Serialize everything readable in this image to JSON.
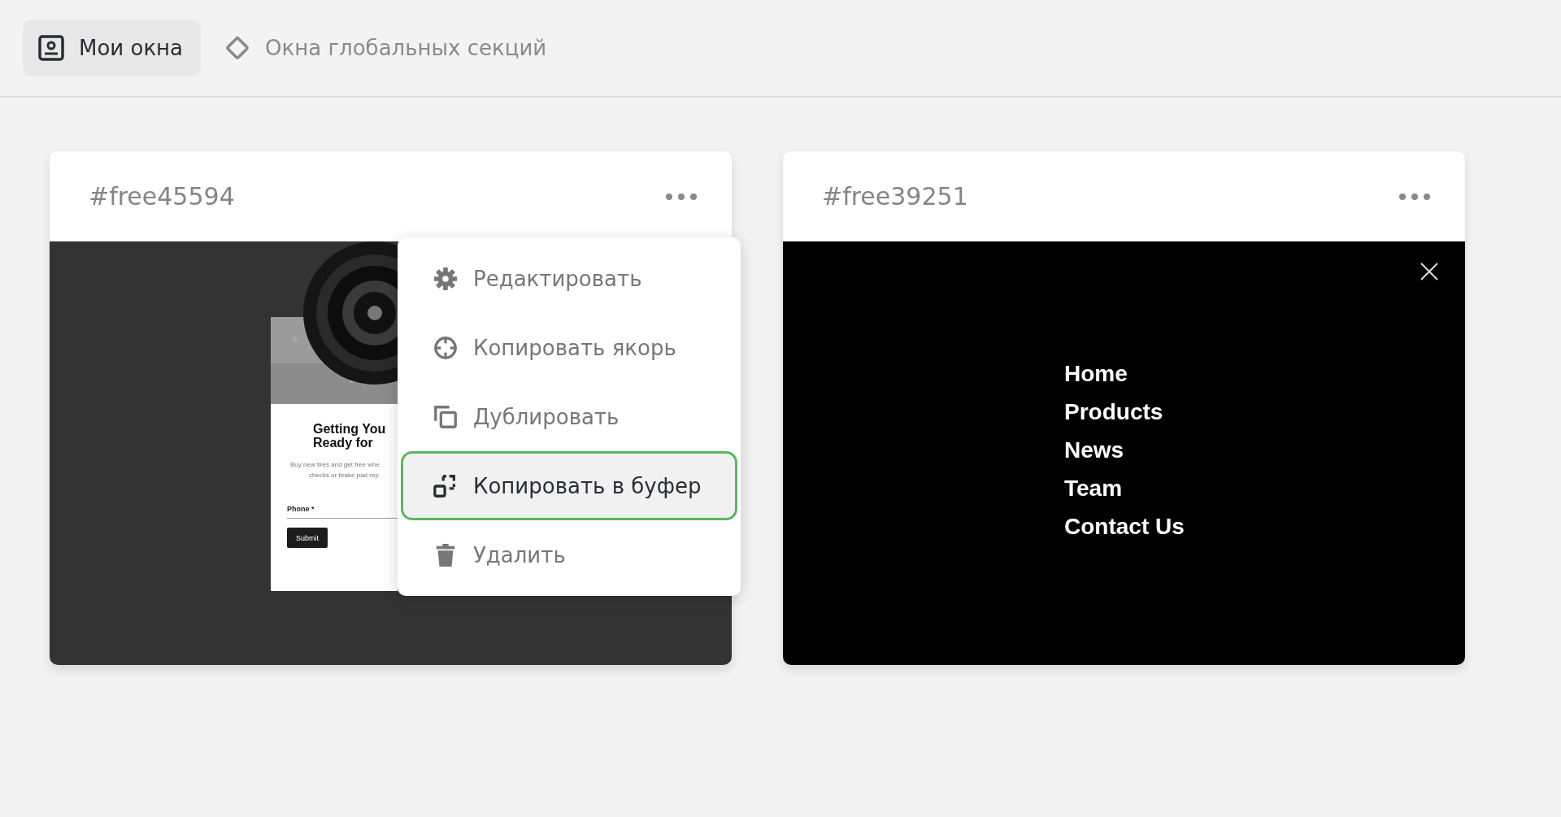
{
  "tabs": [
    {
      "label": "Мои окна",
      "selected": true
    },
    {
      "label": "Окна глобальных секций",
      "selected": false
    }
  ],
  "cards": [
    {
      "title": "#free45594",
      "preview": {
        "kind": "form",
        "heading": [
          "Getting You",
          "Ready for"
        ],
        "text": [
          "Buy new tires and get free whe",
          "checks or brake pad rep"
        ],
        "field_label": "Phone *",
        "button": "Submit"
      },
      "menu": {
        "items": [
          {
            "label": "Редактировать",
            "selected": false
          },
          {
            "label": "Копировать якорь",
            "selected": false
          },
          {
            "label": "Дублировать",
            "selected": false
          },
          {
            "label": "Копировать в буфер",
            "selected": true
          },
          {
            "label": "Удалить",
            "selected": false
          }
        ]
      }
    },
    {
      "title": "#free39251",
      "preview": {
        "kind": "nav",
        "links": [
          "Home",
          "Products",
          "News",
          "Team",
          "Contact Us"
        ]
      }
    }
  ]
}
